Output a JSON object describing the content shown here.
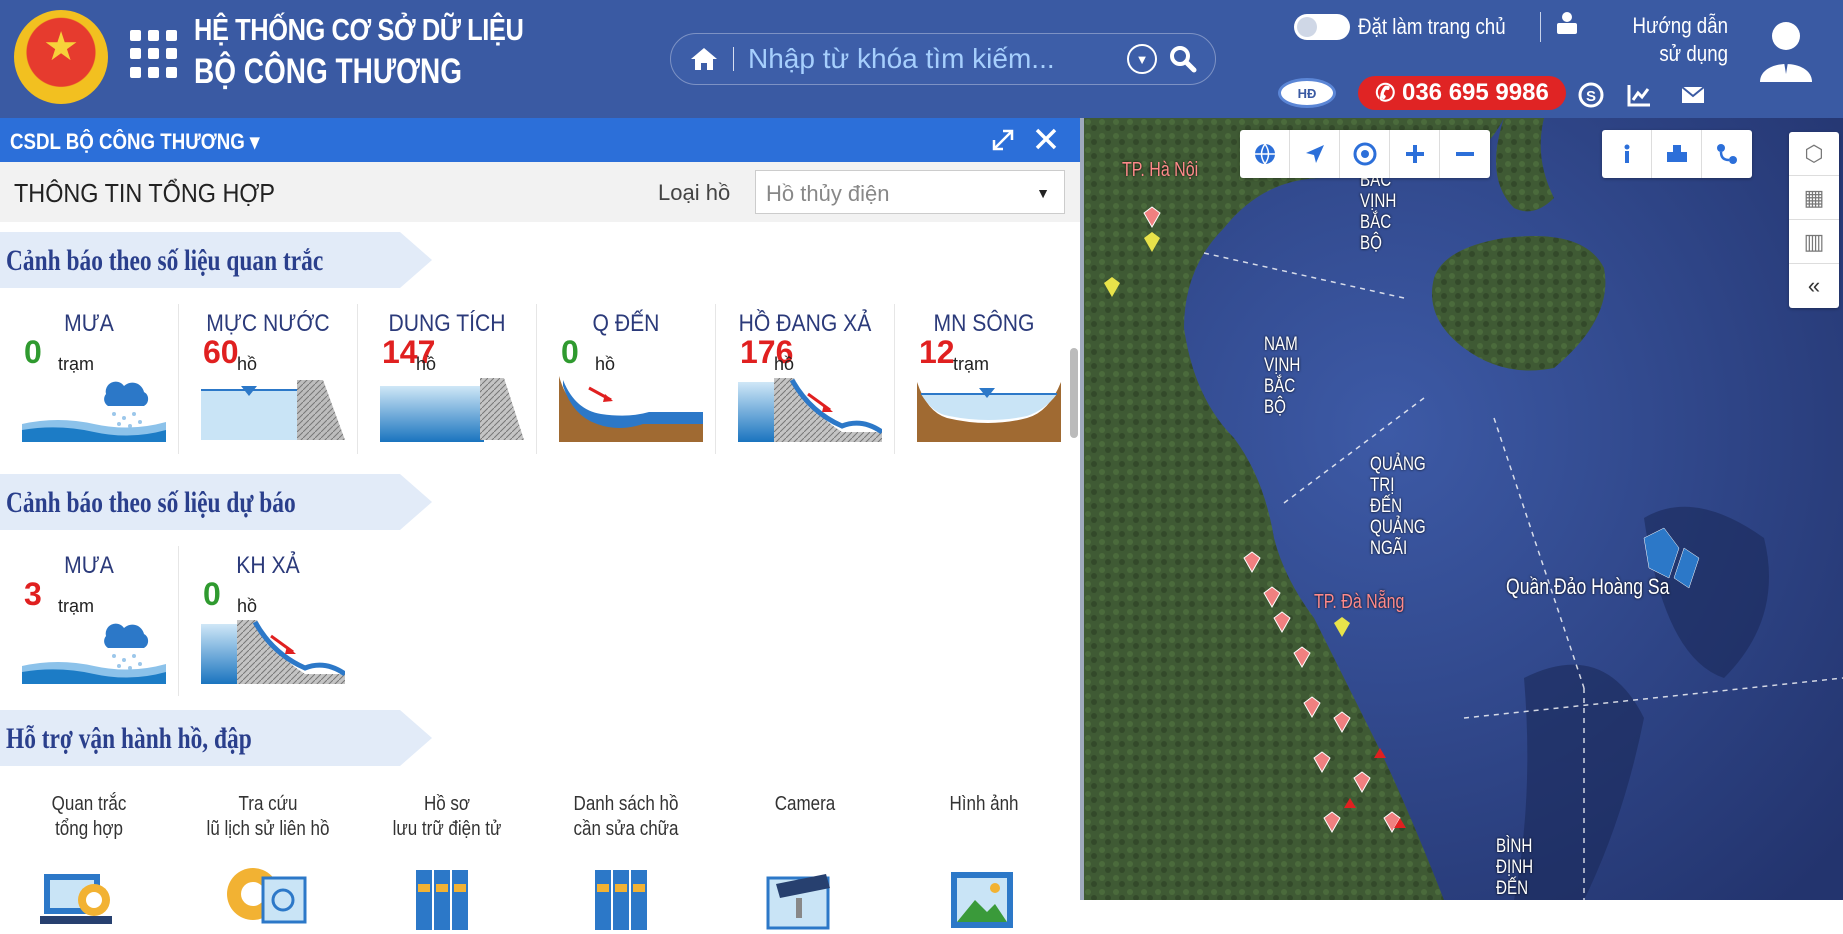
{
  "header": {
    "title_line1": "HỆ THỐNG CƠ SỞ DỮ LIỆU",
    "title_line2": "BỘ CÔNG THƯƠNG",
    "search_placeholder": "Nhập từ khóa tìm kiếm...",
    "set_home_label": "Đặt làm trang chủ",
    "guide_label": "Hướng dẫn sử dụng",
    "hd_badge": "HĐ",
    "phone": "036 695 9986"
  },
  "panel": {
    "title": "CSDL BỘ CÔNG THƯƠNG",
    "heading": "THÔNG TIN TỔNG HỢP",
    "type_label": "Loại hồ",
    "type_value": "Hồ thủy điện",
    "section1": "Cảnh báo theo số liệu quan trắc",
    "section2": "Cảnh báo theo số liệu dự báo",
    "section3": "Hỗ trợ vận hành hồ, đập",
    "monitor_tiles": [
      {
        "label": "MƯA",
        "value": "0",
        "unit": "trạm"
      },
      {
        "label": "MỰC NƯỚC",
        "value": "60",
        "unit": "hồ"
      },
      {
        "label": "DUNG TÍCH",
        "value": "147",
        "unit": "hồ"
      },
      {
        "label": "Q ĐẾN",
        "value": "0",
        "unit": "hồ"
      },
      {
        "label": "HỒ ĐANG XẢ",
        "value": "176",
        "unit": "hồ"
      },
      {
        "label": "MN SÔNG",
        "value": "12",
        "unit": "trạm"
      }
    ],
    "forecast_tiles": [
      {
        "label": "MƯA",
        "value": "3",
        "unit": "trạm"
      },
      {
        "label": "KH XẢ",
        "value": "0",
        "unit": "hồ"
      }
    ],
    "tools": [
      {
        "line1": "Quan trắc",
        "line2": "tổng hợp"
      },
      {
        "line1": "Tra cứu",
        "line2": "lũ lịch sử liên hồ"
      },
      {
        "line1": "Hồ sơ",
        "line2": "lưu trữ điện tử"
      },
      {
        "line1": "Danh sách hồ",
        "line2": "cần sửa chữa"
      },
      {
        "line1": "Camera",
        "line2": ""
      },
      {
        "line1": "Hình ảnh",
        "line2": ""
      }
    ]
  },
  "map": {
    "labels": {
      "hanoi": "TP. Hà Nội",
      "north_gulf": [
        "BẮC",
        "VỊNH",
        "BẮC",
        "BỘ"
      ],
      "south_gulf": [
        "NAM",
        "VỊNH",
        "BẮC",
        "BỘ"
      ],
      "quangtri": [
        "QUẢNG",
        "TRỊ",
        "ĐẾN",
        "QUẢNG",
        "NGÃI"
      ],
      "danang": "TP. Đà Nẵng",
      "hoangsa": "Quần Đảo Hoàng Sa",
      "binhdinh": [
        "BÌNH",
        "ĐỊNH",
        "ĐẾN"
      ]
    }
  },
  "colors": {
    "header": "#3a5aa3",
    "panel_bar": "#2c6fd9",
    "accent_red": "#e02424",
    "green": "#2f9a2f"
  }
}
